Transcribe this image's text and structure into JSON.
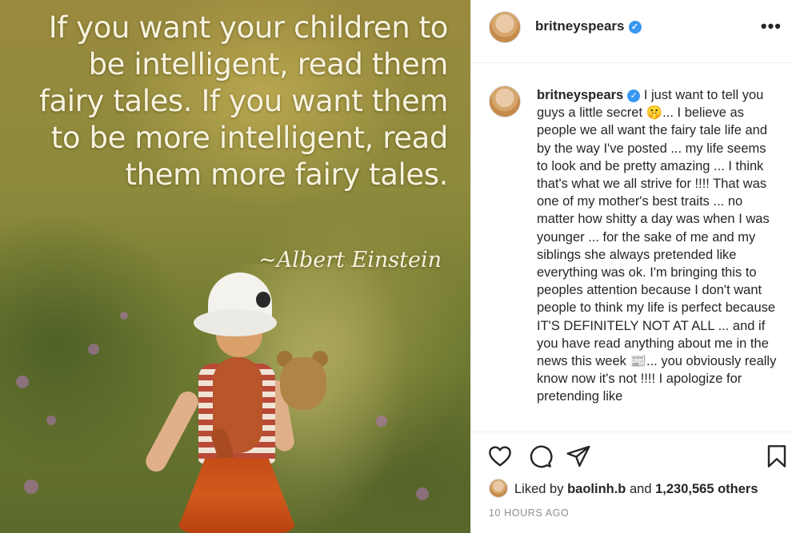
{
  "post_image": {
    "quote": "If you want your children to be intelligent, read them fairy tales. If you want them to be more intelligent, read them more fairy tales.",
    "author": "~Albert Einstein"
  },
  "header": {
    "username": "britneyspears",
    "verified": true,
    "more_label": "•••"
  },
  "caption": {
    "username": "britneyspears",
    "text": "I just want to tell you guys a little secret 🤫... I believe as people we all want the fairy tale life and by the way I've posted ... my life seems to look and be pretty amazing ... I think that's what we all strive for !!!! That was one of my mother's best traits ... no matter how shitty a day was when I was younger ... for the sake of me and my siblings she always pretended like everything was ok. I'm bringing this to peoples attention because I don't want people to think my life is perfect because IT'S DEFINITELY NOT AT ALL ... and if you have read anything about me in the news this week 📰... you obviously really know now it's not !!!! I apologize for pretending like"
  },
  "actions": {
    "liked_by_prefix": "Liked by",
    "liked_by_user": "baolinh.b",
    "and_word": "and",
    "others_count": "1,230,565 others",
    "timestamp": "10 HOURS AGO"
  },
  "colors": {
    "verified_blue": "#3897f0",
    "text_primary": "#262626",
    "text_secondary": "#8e8e8e",
    "border": "#efefef"
  }
}
